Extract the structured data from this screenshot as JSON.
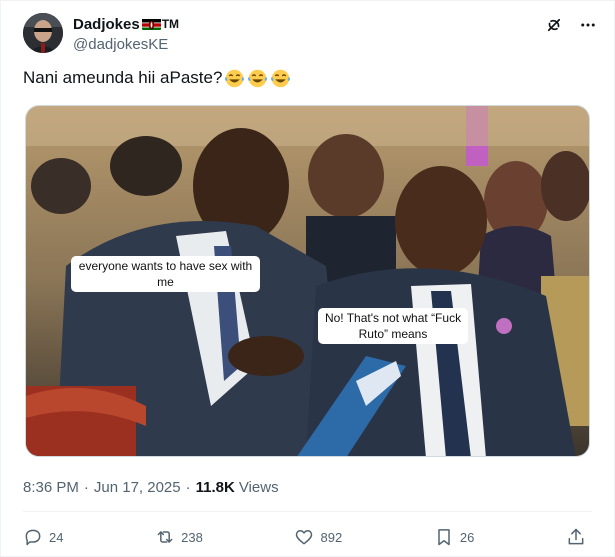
{
  "author": {
    "display_name": "Dadjokes",
    "tm_mark": "TM",
    "handle": "@dadjokesKE"
  },
  "icons": {
    "verified_menu": "grok-icon",
    "more": "more-icon",
    "flag": "kenya-flag-icon",
    "emoji": "tears-of-joy-icon"
  },
  "tweet": {
    "text": "Nani ameunda hii aPaste?",
    "emoji_count": 3
  },
  "media": {
    "caption_1": "everyone wants to have sex with me",
    "caption_2": "No! That's not what “Fuck Ruto” means"
  },
  "meta": {
    "time": "8:36 PM",
    "date": "Jun 17, 2025",
    "views_count": "11.8K",
    "views_label": "Views"
  },
  "actions": {
    "replies": "24",
    "reposts": "238",
    "likes": "892",
    "bookmarks": "26"
  },
  "colors": {
    "text_primary": "#0f1419",
    "text_secondary": "#536471",
    "border": "#eff3f4"
  }
}
